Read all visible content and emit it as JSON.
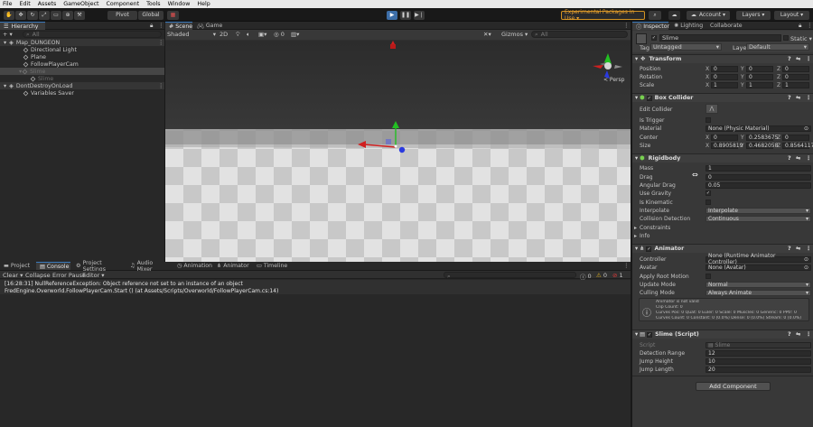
{
  "menu": [
    "File",
    "Edit",
    "Assets",
    "GameObject",
    "Component",
    "Tools",
    "Window",
    "Help"
  ],
  "toolbar": {
    "pivot": "Pivot",
    "global": "Global",
    "experimental": "Experimental Packages In Use ▾",
    "account": "Account ▾",
    "layers": "Layers ▾",
    "layout": "Layout ▾"
  },
  "hierarchy": {
    "tab": "Hierarchy",
    "search_placeholder": "All",
    "items": [
      {
        "label": "Map_DUNGEON"
      },
      {
        "label": "Directional Light"
      },
      {
        "label": "Plane"
      },
      {
        "label": "FollowPlayerCam"
      },
      {
        "label": "Slime"
      },
      {
        "label": "Slime"
      },
      {
        "label": "DontDestroyOnLoad"
      },
      {
        "label": "Variables Saver"
      }
    ]
  },
  "scene": {
    "tabs": [
      "Scene",
      "Game"
    ],
    "shaded": "Shaded",
    "mode2d": "2D",
    "gizmos": "Gizmos ▾",
    "search_placeholder": "All",
    "persp": "< Persp"
  },
  "bottom": {
    "tabs": [
      "Project",
      "Console",
      "Project Settings",
      "Audio Mixer",
      "Animation",
      "Animator",
      "Timeline"
    ],
    "clear": "Clear ▾",
    "collapse": "Collapse",
    "error_pause": "Error Pause",
    "editor": "Editor ▾",
    "counts": {
      "info": "0",
      "warn": "0",
      "error": "1"
    },
    "log": {
      "line1": "[16:28:31] NullReferenceException: Object reference not set to an instance of an object",
      "line2": "FredEngine.Overworld.FollowPlayerCam.Start () (at Assets/Scripts/Overworld/FollowPlayerCam.cs:14)"
    }
  },
  "inspector": {
    "tabs": [
      "Inspector",
      "Lighting",
      "Collaborate"
    ],
    "object_name": "Slime",
    "static_label": "Static ▾",
    "tag_label": "Tag",
    "tag_value": "Untagged",
    "layer_label": "Layer",
    "layer_value": "Default",
    "transform": {
      "title": "Transform",
      "position_label": "Position",
      "position": [
        "0",
        "0",
        "0"
      ],
      "rotation_label": "Rotation",
      "rotation": [
        "0",
        "0",
        "0"
      ],
      "scale_label": "Scale",
      "scale": [
        "1",
        "1",
        "1"
      ]
    },
    "box_collider": {
      "title": "Box Collider",
      "edit_collider": "Edit Collider",
      "is_trigger": "Is Trigger",
      "material_label": "Material",
      "material": "None (Physic Material)",
      "center_label": "Center",
      "center": [
        "0",
        "0.2583675",
        "0"
      ],
      "size_label": "Size",
      "size": [
        "0.8905819",
        "0.4682058",
        "0.8564117"
      ]
    },
    "rigidbody": {
      "title": "Rigidbody",
      "mass_label": "Mass",
      "mass": "1",
      "drag_label": "Drag",
      "drag": "0",
      "angular_drag_label": "Angular Drag",
      "angular_drag": "0.05",
      "use_gravity": "Use Gravity",
      "is_kinematic": "Is Kinematic",
      "interpolate_label": "Interpolate",
      "interpolate": "Interpolate",
      "collision_label": "Collision Detection",
      "collision": "Continuous",
      "constraints": "Constraints",
      "info": "Info"
    },
    "animator": {
      "title": "Animator",
      "controller_label": "Controller",
      "controller": "None (Runtime Animator Controller)",
      "avatar_label": "Avatar",
      "avatar": "None (Avatar)",
      "root_motion": "Apply Root Motion",
      "update_label": "Update Mode",
      "update": "Normal",
      "culling_label": "Culling Mode",
      "culling": "Always Animate",
      "info1": "Animator is not valid",
      "info2": "Clip Count: 0",
      "info3": "Curves Pos: 0 Quat: 0 Euler: 0 Scale: 0 Muscles: 0 Generic: 0 PPtr: 0",
      "info4": "Curves Count: 0 Constant: 0 (0.0%) Dense: 0 (0.0%) Stream: 0 (0.0%)"
    },
    "slime_script": {
      "title": "Slime (Script)",
      "script_label": "Script",
      "script": "Slime",
      "detection_label": "Detection Range",
      "detection": "12",
      "jump_height_label": "Jump Height",
      "jump_height": "10",
      "jump_length_label": "Jump Length",
      "jump_length": "20"
    },
    "add_component": "Add Component"
  },
  "colors": {
    "accent_blue": "#3a79bb",
    "gizmo_green": "#22c022",
    "gizmo_red": "#d02020",
    "gizmo_blue": "#2a3adf",
    "experimental_border": "#d29222"
  }
}
